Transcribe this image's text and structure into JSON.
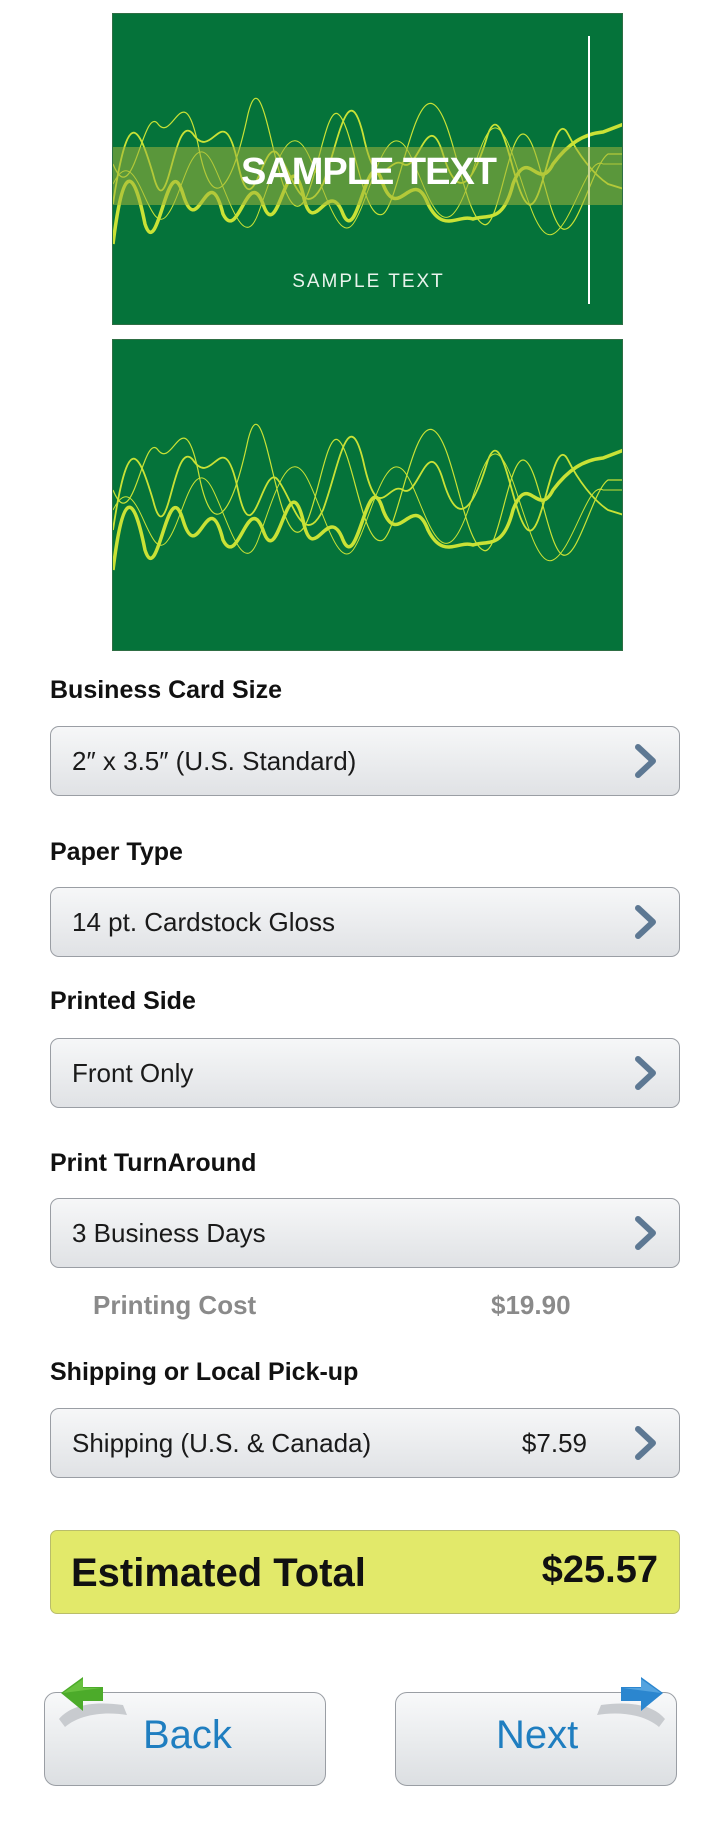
{
  "preview": {
    "front_title": "SAMPLE TEXT",
    "front_subtitle": "SAMPLE TEXT",
    "card_color": "#05733a",
    "wave_color": "#c9e236"
  },
  "options": [
    {
      "key": "size",
      "label": "Business Card Size",
      "value": "2″ x 3.5″ (U.S. Standard)",
      "icon": "chevron-right-icon"
    },
    {
      "key": "paper",
      "label": "Paper Type",
      "value": "14 pt. Cardstock Gloss",
      "icon": "chevron-right-icon"
    },
    {
      "key": "side",
      "label": "Printed Side",
      "value": "Front Only",
      "icon": "chevron-right-icon"
    },
    {
      "key": "turnaround",
      "label": "Print TurnAround",
      "value": "3 Business Days",
      "icon": "chevron-right-icon"
    }
  ],
  "printing_cost": {
    "label": "Printing Cost",
    "value": "$19.90"
  },
  "shipping": {
    "label": "Shipping or Local Pick-up",
    "value": "Shipping (U.S. & Canada)",
    "price": "$7.59",
    "icon": "chevron-right-icon"
  },
  "estimate": {
    "label": "Estimated Total",
    "value": "$25.57",
    "color": "#e2e96a"
  },
  "nav": {
    "back_label": "Back",
    "next_label": "Next",
    "back_icon": "green-left-arrow-icon",
    "next_icon": "blue-right-arrow-icon"
  }
}
